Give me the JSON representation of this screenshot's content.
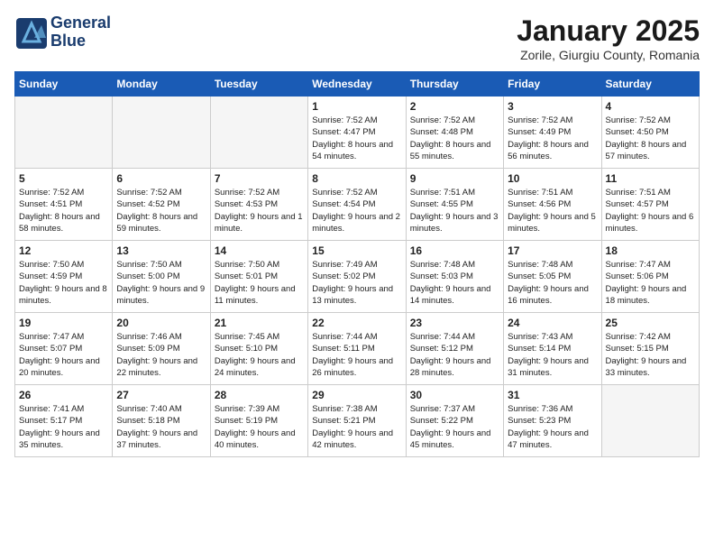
{
  "logo": {
    "line1": "General",
    "line2": "Blue"
  },
  "title": "January 2025",
  "location": "Zorile, Giurgiu County, Romania",
  "weekdays": [
    "Sunday",
    "Monday",
    "Tuesday",
    "Wednesday",
    "Thursday",
    "Friday",
    "Saturday"
  ],
  "weeks": [
    [
      {
        "day": "",
        "info": ""
      },
      {
        "day": "",
        "info": ""
      },
      {
        "day": "",
        "info": ""
      },
      {
        "day": "1",
        "info": "Sunrise: 7:52 AM\nSunset: 4:47 PM\nDaylight: 8 hours\nand 54 minutes."
      },
      {
        "day": "2",
        "info": "Sunrise: 7:52 AM\nSunset: 4:48 PM\nDaylight: 8 hours\nand 55 minutes."
      },
      {
        "day": "3",
        "info": "Sunrise: 7:52 AM\nSunset: 4:49 PM\nDaylight: 8 hours\nand 56 minutes."
      },
      {
        "day": "4",
        "info": "Sunrise: 7:52 AM\nSunset: 4:50 PM\nDaylight: 8 hours\nand 57 minutes."
      }
    ],
    [
      {
        "day": "5",
        "info": "Sunrise: 7:52 AM\nSunset: 4:51 PM\nDaylight: 8 hours\nand 58 minutes."
      },
      {
        "day": "6",
        "info": "Sunrise: 7:52 AM\nSunset: 4:52 PM\nDaylight: 8 hours\nand 59 minutes."
      },
      {
        "day": "7",
        "info": "Sunrise: 7:52 AM\nSunset: 4:53 PM\nDaylight: 9 hours\nand 1 minute."
      },
      {
        "day": "8",
        "info": "Sunrise: 7:52 AM\nSunset: 4:54 PM\nDaylight: 9 hours\nand 2 minutes."
      },
      {
        "day": "9",
        "info": "Sunrise: 7:51 AM\nSunset: 4:55 PM\nDaylight: 9 hours\nand 3 minutes."
      },
      {
        "day": "10",
        "info": "Sunrise: 7:51 AM\nSunset: 4:56 PM\nDaylight: 9 hours\nand 5 minutes."
      },
      {
        "day": "11",
        "info": "Sunrise: 7:51 AM\nSunset: 4:57 PM\nDaylight: 9 hours\nand 6 minutes."
      }
    ],
    [
      {
        "day": "12",
        "info": "Sunrise: 7:50 AM\nSunset: 4:59 PM\nDaylight: 9 hours\nand 8 minutes."
      },
      {
        "day": "13",
        "info": "Sunrise: 7:50 AM\nSunset: 5:00 PM\nDaylight: 9 hours\nand 9 minutes."
      },
      {
        "day": "14",
        "info": "Sunrise: 7:50 AM\nSunset: 5:01 PM\nDaylight: 9 hours\nand 11 minutes."
      },
      {
        "day": "15",
        "info": "Sunrise: 7:49 AM\nSunset: 5:02 PM\nDaylight: 9 hours\nand 13 minutes."
      },
      {
        "day": "16",
        "info": "Sunrise: 7:48 AM\nSunset: 5:03 PM\nDaylight: 9 hours\nand 14 minutes."
      },
      {
        "day": "17",
        "info": "Sunrise: 7:48 AM\nSunset: 5:05 PM\nDaylight: 9 hours\nand 16 minutes."
      },
      {
        "day": "18",
        "info": "Sunrise: 7:47 AM\nSunset: 5:06 PM\nDaylight: 9 hours\nand 18 minutes."
      }
    ],
    [
      {
        "day": "19",
        "info": "Sunrise: 7:47 AM\nSunset: 5:07 PM\nDaylight: 9 hours\nand 20 minutes."
      },
      {
        "day": "20",
        "info": "Sunrise: 7:46 AM\nSunset: 5:09 PM\nDaylight: 9 hours\nand 22 minutes."
      },
      {
        "day": "21",
        "info": "Sunrise: 7:45 AM\nSunset: 5:10 PM\nDaylight: 9 hours\nand 24 minutes."
      },
      {
        "day": "22",
        "info": "Sunrise: 7:44 AM\nSunset: 5:11 PM\nDaylight: 9 hours\nand 26 minutes."
      },
      {
        "day": "23",
        "info": "Sunrise: 7:44 AM\nSunset: 5:12 PM\nDaylight: 9 hours\nand 28 minutes."
      },
      {
        "day": "24",
        "info": "Sunrise: 7:43 AM\nSunset: 5:14 PM\nDaylight: 9 hours\nand 31 minutes."
      },
      {
        "day": "25",
        "info": "Sunrise: 7:42 AM\nSunset: 5:15 PM\nDaylight: 9 hours\nand 33 minutes."
      }
    ],
    [
      {
        "day": "26",
        "info": "Sunrise: 7:41 AM\nSunset: 5:17 PM\nDaylight: 9 hours\nand 35 minutes."
      },
      {
        "day": "27",
        "info": "Sunrise: 7:40 AM\nSunset: 5:18 PM\nDaylight: 9 hours\nand 37 minutes."
      },
      {
        "day": "28",
        "info": "Sunrise: 7:39 AM\nSunset: 5:19 PM\nDaylight: 9 hours\nand 40 minutes."
      },
      {
        "day": "29",
        "info": "Sunrise: 7:38 AM\nSunset: 5:21 PM\nDaylight: 9 hours\nand 42 minutes."
      },
      {
        "day": "30",
        "info": "Sunrise: 7:37 AM\nSunset: 5:22 PM\nDaylight: 9 hours\nand 45 minutes."
      },
      {
        "day": "31",
        "info": "Sunrise: 7:36 AM\nSunset: 5:23 PM\nDaylight: 9 hours\nand 47 minutes."
      },
      {
        "day": "",
        "info": ""
      }
    ]
  ]
}
